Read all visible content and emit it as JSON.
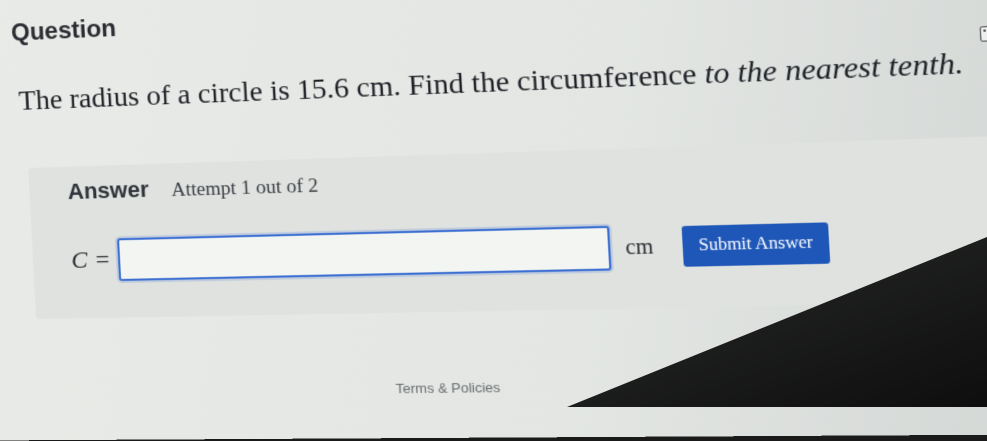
{
  "question": {
    "heading": "Question",
    "text_before": "The radius of a circle is 15.6 cm. Find the circumference ",
    "text_italic": "to the nearest tenth."
  },
  "answer": {
    "label": "Answer",
    "attempt": "Attempt 1 out of 2",
    "variable": "C",
    "equals": "=",
    "input_value": "",
    "unit": "cm",
    "submit_label": "Submit Answer"
  },
  "footer": {
    "terms_label": "Terms & Policies"
  },
  "icons": {
    "keyboard": "keyboard-icon"
  },
  "colors": {
    "accent": "#1f57b8",
    "input_border": "#3c6fd1"
  }
}
